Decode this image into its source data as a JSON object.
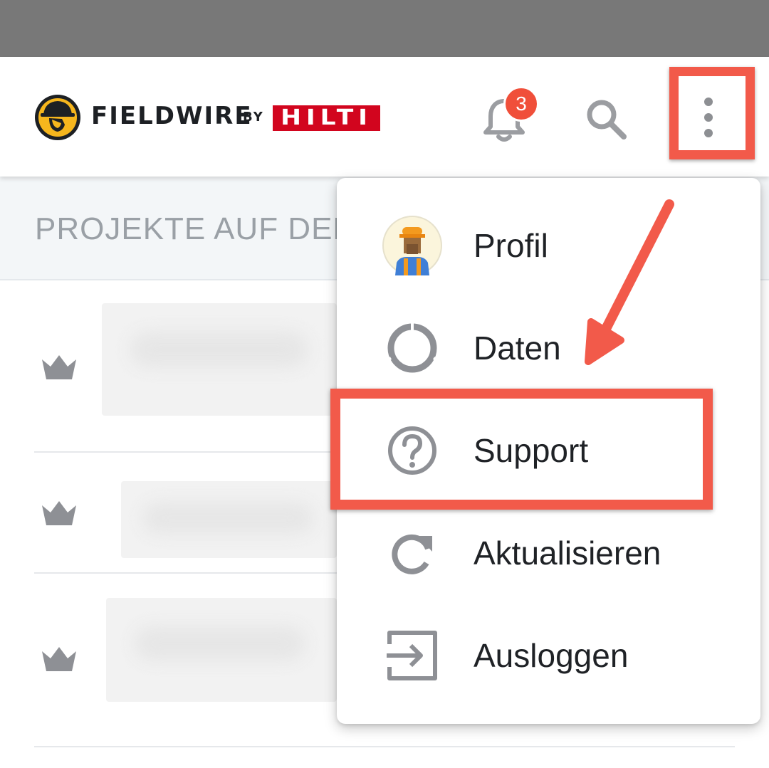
{
  "header": {
    "brand_name": "FIELDWIRE",
    "brand_by": "BY",
    "partner_name": "HILTI",
    "notifications_count": "3"
  },
  "section": {
    "title": "PROJEKTE AUF DEM"
  },
  "projects": [
    {
      "icon": "crown-icon"
    },
    {
      "icon": "crown-icon"
    },
    {
      "icon": "crown-icon"
    }
  ],
  "menu": {
    "items": [
      {
        "label": "Profil",
        "icon": "avatar"
      },
      {
        "label": "Daten",
        "icon": "storage-ring-icon"
      },
      {
        "label": "Support",
        "icon": "help-circle-icon"
      },
      {
        "label": "Aktualisieren",
        "icon": "refresh-icon"
      },
      {
        "label": "Ausloggen",
        "icon": "logout-icon"
      }
    ]
  },
  "colors": {
    "highlight": "#f25a4a",
    "hilti_red": "#d2051e",
    "badge": "#f04f3a",
    "logo_yellow": "#f6b61d"
  }
}
